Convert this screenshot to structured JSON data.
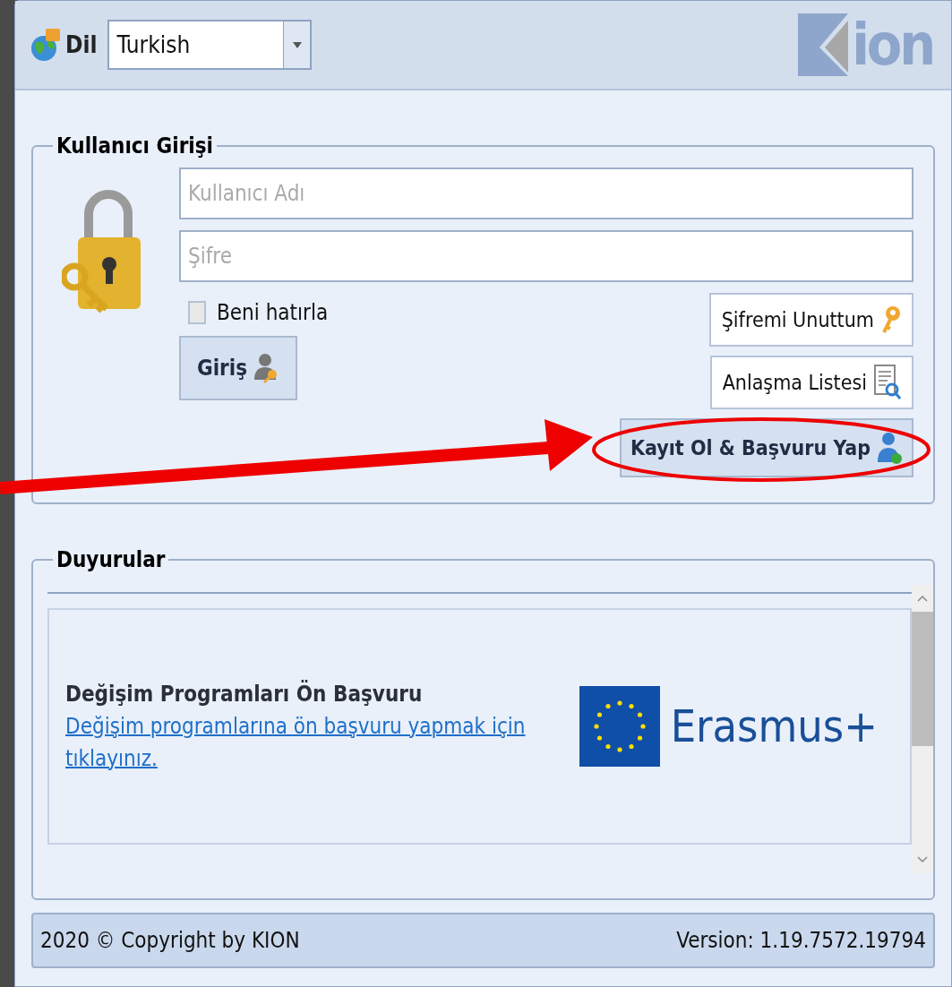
{
  "header": {
    "language_label": "Dil",
    "language_select": {
      "value": "Turkish"
    },
    "logo_text": "ion"
  },
  "login": {
    "legend": "Kullanıcı Girişi",
    "username": {
      "placeholder": "Kullanıcı Adı"
    },
    "password": {
      "placeholder": "Şifre"
    },
    "remember": {
      "label": "Beni hatırla",
      "checked": false
    },
    "login_button": "Giriş",
    "forgot_button": "Şifremi Unuttum",
    "agreements_button": "Anlaşma Listesi",
    "register_button": "Kayıt Ol & Başvuru Yap"
  },
  "announcements": {
    "legend": "Duyurular",
    "items": [
      {
        "title": "Değişim Programları Ön Başvuru",
        "link": "Değişim programlarına ön başvuru yapmak için tıklayınız.",
        "logo_text": "Erasmus+"
      }
    ]
  },
  "status_bar": {
    "copyright": "2020 © Copyright by KION",
    "version": "Version: 1.19.7572.19794"
  }
}
